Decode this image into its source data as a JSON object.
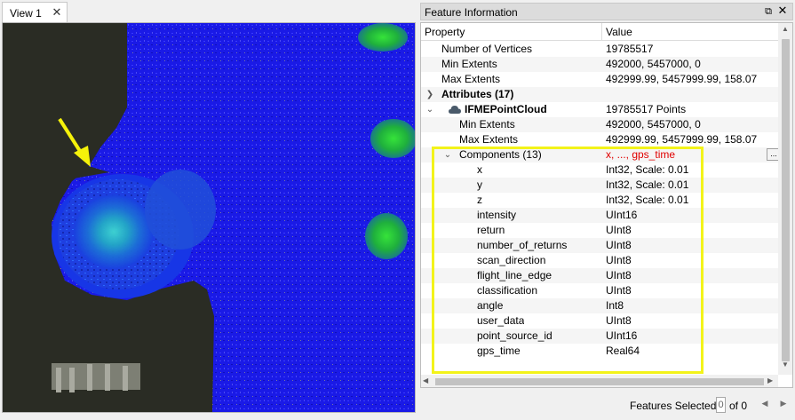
{
  "view": {
    "tab_label": "View 1",
    "close_glyph": "✕"
  },
  "panel": {
    "title": "Feature Information",
    "float_glyph": "⧉",
    "close_glyph": "✕"
  },
  "table": {
    "headers": {
      "property": "Property",
      "value": "Value"
    },
    "rows": [
      {
        "property": "Number of Vertices",
        "value": "19785517"
      },
      {
        "property": "Min Extents",
        "value": "492000, 5457000, 0"
      },
      {
        "property": "Max Extents",
        "value": "492999.99, 5457999.99, 158.07"
      },
      {
        "property": "Attributes (17)",
        "value": ""
      },
      {
        "property": "IFMEPointCloud",
        "value": "19785517 Points"
      },
      {
        "property": "Min Extents",
        "value": "492000, 5457000, 0"
      },
      {
        "property": "Max Extents",
        "value": "492999.99, 5457999.99, 158.07"
      },
      {
        "property": "Components (13)",
        "value": "x, ..., gps_time"
      },
      {
        "property": "x",
        "value": "Int32, Scale: 0.01"
      },
      {
        "property": "y",
        "value": "Int32, Scale: 0.01"
      },
      {
        "property": "z",
        "value": "Int32, Scale: 0.01"
      },
      {
        "property": "intensity",
        "value": "UInt16"
      },
      {
        "property": "return",
        "value": "UInt8"
      },
      {
        "property": "number_of_returns",
        "value": "UInt8"
      },
      {
        "property": "scan_direction",
        "value": "UInt8"
      },
      {
        "property": "flight_line_edge",
        "value": "UInt8"
      },
      {
        "property": "classification",
        "value": "UInt8"
      },
      {
        "property": "angle",
        "value": "Int8"
      },
      {
        "property": "user_data",
        "value": "UInt8"
      },
      {
        "property": "point_source_id",
        "value": "UInt16"
      },
      {
        "property": "gps_time",
        "value": "Real64"
      }
    ],
    "ellipsis_label": "..."
  },
  "status": {
    "label": "Features Selected:",
    "count": "0",
    "of_total": "of 0"
  },
  "colors": {
    "highlight": "#f3f31a",
    "red_value": "#e00000",
    "arrow": "#f5f20a"
  },
  "icons": [
    "close-icon",
    "float-icon",
    "cloud-icon",
    "chevron-right-icon",
    "chevron-down-icon",
    "arrow-left-icon",
    "arrow-right-icon"
  ]
}
